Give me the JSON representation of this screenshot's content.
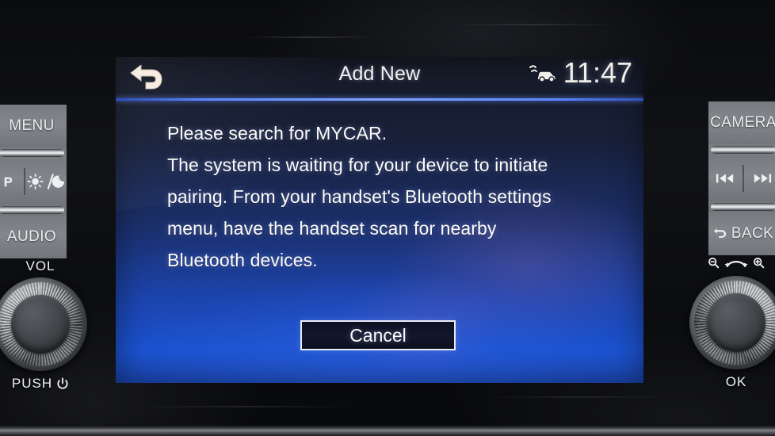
{
  "device": {
    "name": "car-infotainment-head-unit"
  },
  "screen": {
    "header": {
      "back_icon": "back-arrow-icon",
      "title": "Add New",
      "status": {
        "car_icon": "car-connected-icon",
        "clock": "11:47"
      }
    },
    "message": {
      "lines": [
        "Please search for MYCAR.",
        "The system is waiting for your device to initiate",
        "pairing. From your handset's Bluetooth settings",
        "menu, have the handset scan for nearby",
        "Bluetooth devices."
      ]
    },
    "cancel_label": "Cancel"
  },
  "left_keys": {
    "menu_label": "MENU",
    "rocker_top": "rocker-bar",
    "display_mode": {
      "left_icon": "map-icon",
      "sun_icon": "sun-icon",
      "separator": "/",
      "moon_icon": "moon-icon"
    },
    "rocker_bottom": "rocker-bar",
    "audio_label": "AUDIO"
  },
  "right_keys": {
    "camera_label": "CAMERA",
    "rocker_top": "rocker-bar",
    "track": {
      "prev_icon": "previous-track-icon",
      "next_icon": "next-track-icon"
    },
    "rocker_bottom": "rocker-bar",
    "back_label": "BACK",
    "back_icon": "back-return-icon"
  },
  "knobs": {
    "volume": {
      "top_label": "VOL",
      "bottom_label": "PUSH",
      "power_icon": "power-icon"
    },
    "ok": {
      "zoom_out_icon": "zoom-out-icon",
      "rotate_icon": "rotate-arrow-icon",
      "zoom_in_icon": "zoom-in-icon",
      "bottom_label": "OK"
    }
  },
  "colors": {
    "accent_line": "#5b86ff",
    "screen_top": "#161a26",
    "screen_bottom": "#1b52cf",
    "text": "#fdfcfa",
    "key_face": "#7b7f83"
  }
}
